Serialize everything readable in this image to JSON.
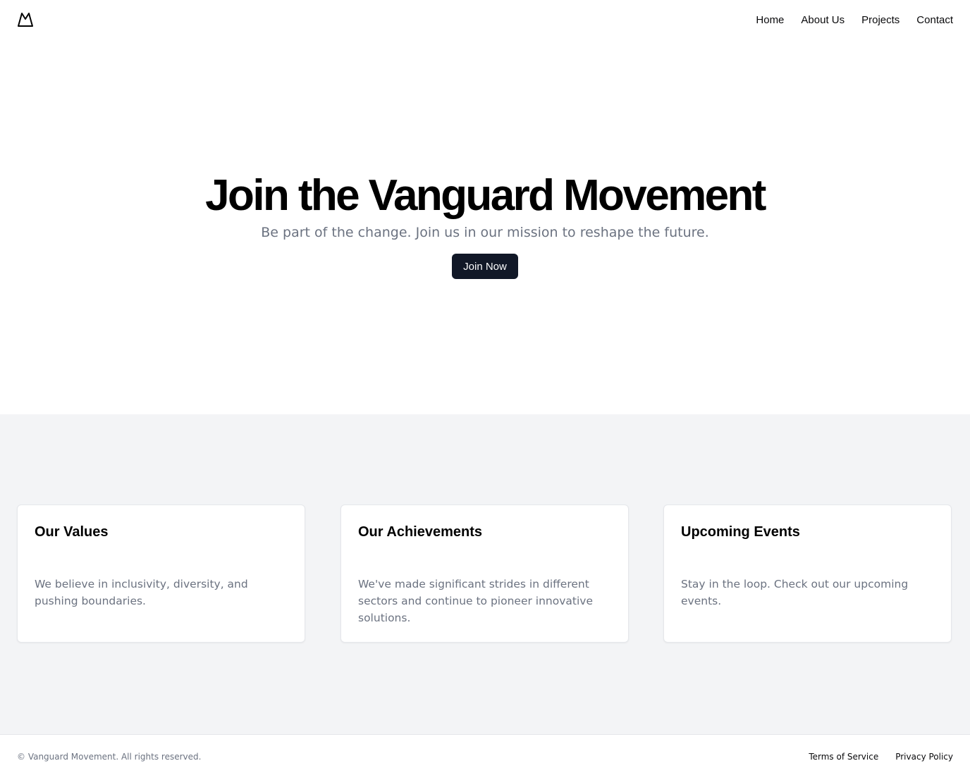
{
  "header": {
    "logo_icon": "mountain-icon",
    "nav": [
      {
        "label": "Home"
      },
      {
        "label": "About Us"
      },
      {
        "label": "Projects"
      },
      {
        "label": "Contact"
      }
    ]
  },
  "hero": {
    "title": "Join the Vanguard Movement",
    "subtitle": "Be part of the change. Join us in our mission to reshape the future.",
    "cta_label": "Join Now"
  },
  "features": [
    {
      "title": "Our Values",
      "text": "We believe in inclusivity, diversity, and pushing boundaries."
    },
    {
      "title": "Our Achievements",
      "text": "We've made significant strides in different sectors and continue to pioneer innovative solutions."
    },
    {
      "title": "Upcoming Events",
      "text": "Stay in the loop. Check out our upcoming events."
    }
  ],
  "footer": {
    "copyright": "© Vanguard Movement. All rights reserved.",
    "links": [
      {
        "label": "Terms of Service"
      },
      {
        "label": "Privacy Policy"
      }
    ]
  },
  "colors": {
    "button_bg": "#111827",
    "muted_text": "#6b7280",
    "section_bg": "#f3f4f6"
  }
}
